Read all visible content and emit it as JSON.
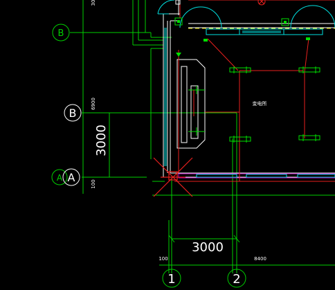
{
  "colors": {
    "background": "#000000",
    "axis": "#00d000",
    "wall": "#ffffff",
    "pipe": "#e8201e",
    "fixture": "#00e0e0",
    "fixture_bar": "#00c0c0",
    "equipment": "#00e000",
    "magenta": "#c000c0",
    "yellow": "#e0e000",
    "orange": "#ff8000",
    "text": "#ffffff"
  },
  "grid": {
    "bubble_b_upper": "B",
    "bubble_b_lower": "B",
    "bubble_a_left": "A",
    "bubble_a_right": "A",
    "bubble_1": "1",
    "bubble_2": "2"
  },
  "dimensions": {
    "vertical_large": "3000",
    "vertical_small_6900": "6900",
    "vertical_small_100": "100",
    "vertical_small_top": "30",
    "horizontal_large": "3000",
    "horizontal_small_100": "100",
    "horizontal_small_8400": "8400"
  },
  "room": {
    "label": "变电所"
  },
  "icons": [
    "circle-x-icon"
  ]
}
